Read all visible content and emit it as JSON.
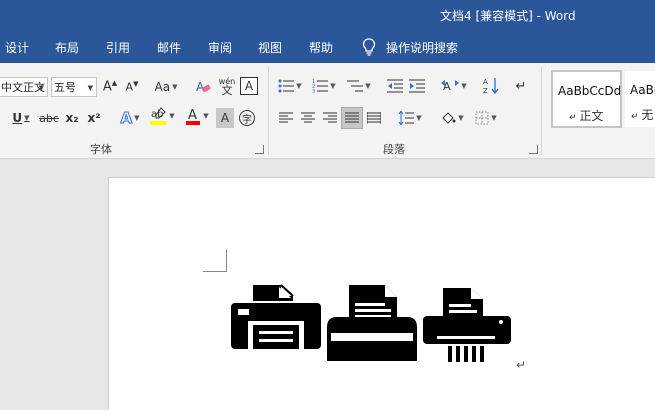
{
  "window": {
    "title": "文档4 [兼容模式]  -  Word"
  },
  "menu": {
    "tabs": [
      "设计",
      "布局",
      "引用",
      "邮件",
      "审阅",
      "视图",
      "帮助"
    ],
    "tell_me": "操作说明搜索"
  },
  "ribbon": {
    "font": {
      "group_label": "字体",
      "font_name": "中文正文",
      "font_size": "五号",
      "change_case": "Aa",
      "phonetic": "wén",
      "enclose_char": "A",
      "abc": "abc",
      "subscript": "x₂",
      "superscript": "x²"
    },
    "paragraph": {
      "group_label": "段落"
    },
    "styles": {
      "items": [
        {
          "sample": "AaBbCcDd",
          "name": "正文"
        },
        {
          "sample": "AaBb",
          "name": "无"
        }
      ]
    }
  },
  "colors": {
    "accent": "#2b579a",
    "highlight": "#ffff00",
    "font_color": "#ff0000"
  },
  "document": {
    "content": [
      "printer-icon",
      "printer-document-icon",
      "shredder-icon"
    ],
    "paragraph_mark": "↵"
  }
}
